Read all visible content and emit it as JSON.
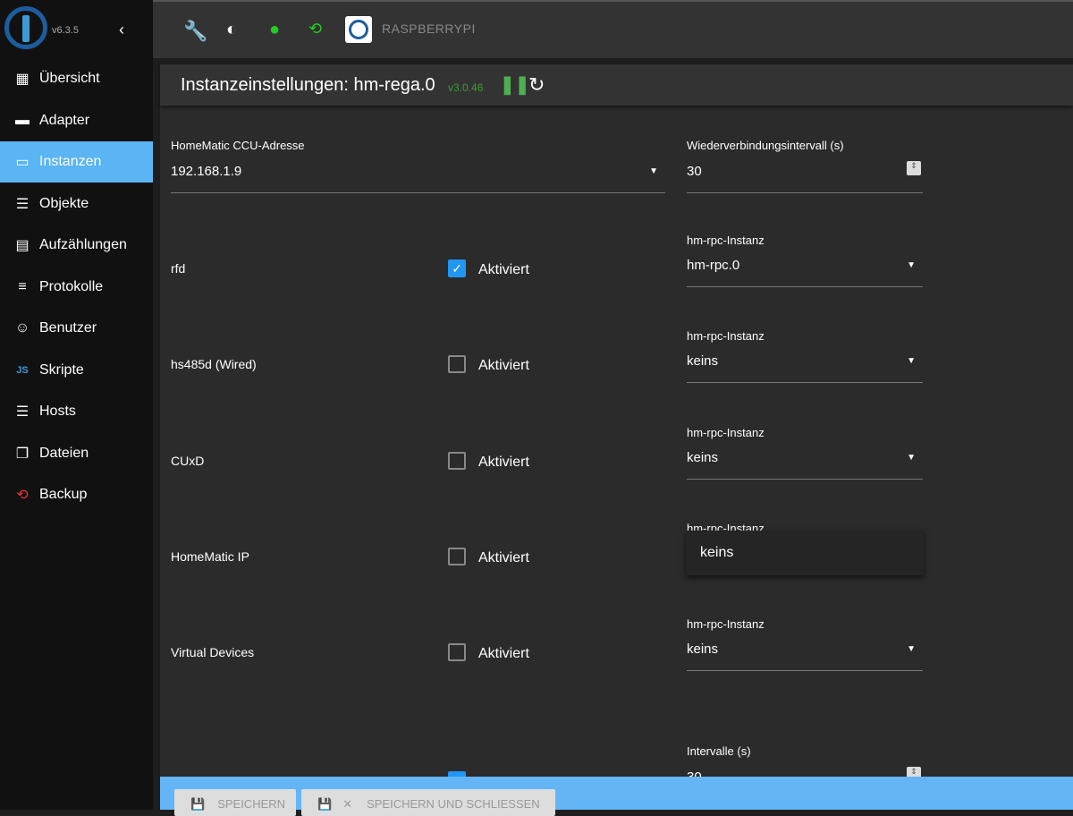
{
  "sidebar": {
    "version": "v6.3.5",
    "items": [
      {
        "label": "Übersicht",
        "icon": "grid-icon"
      },
      {
        "label": "Adapter",
        "icon": "store-icon"
      },
      {
        "label": "Instanzen",
        "icon": "instances-icon",
        "active": true
      },
      {
        "label": "Objekte",
        "icon": "list-icon"
      },
      {
        "label": "Aufzählungen",
        "icon": "enum-icon"
      },
      {
        "label": "Protokolle",
        "icon": "log-icon"
      },
      {
        "label": "Benutzer",
        "icon": "user-icon"
      },
      {
        "label": "Skripte",
        "icon": "js-icon"
      },
      {
        "label": "Hosts",
        "icon": "hosts-icon"
      },
      {
        "label": "Dateien",
        "icon": "file-icon"
      },
      {
        "label": "Backup",
        "icon": "backup-icon"
      }
    ]
  },
  "topbar": {
    "host": "RASPBERRYPI"
  },
  "panel": {
    "title": "Instanzeinstellungen: hm-rega.0",
    "version": "v3.0.46",
    "ccu_label": "HomeMatic CCU-Adresse",
    "ccu_value": "192.168.1.9",
    "reconnect_label": "Wiederverbindungsintervall (s)",
    "reconnect_value": "30",
    "rows": [
      {
        "label": "rfd",
        "checked": true,
        "check_label": "Aktiviert",
        "inst_label": "hm-rpc-Instanz",
        "inst_value": "hm-rpc.0"
      },
      {
        "label": "hs485d (Wired)",
        "checked": false,
        "check_label": "Aktiviert",
        "inst_label": "hm-rpc-Instanz",
        "inst_value": "keins"
      },
      {
        "label": "CUxD",
        "checked": false,
        "check_label": "Aktiviert",
        "inst_label": "hm-rpc-Instanz",
        "inst_value": "keins"
      },
      {
        "label": "HomeMatic IP",
        "checked": false,
        "check_label": "Aktiviert",
        "inst_label": "hm-rpc-Instanz",
        "inst_value": "keins"
      },
      {
        "label": "Virtual Devices",
        "checked": false,
        "check_label": "Aktiviert",
        "inst_label": "hm-rpc-Instanz",
        "inst_value": "keins"
      }
    ],
    "interval_label": "Intervalle (s)",
    "interval_value": "30"
  },
  "footer": {
    "save": "SPEICHERN",
    "save_close": "SPEICHERN UND SCHLIESSEN"
  },
  "colors": {
    "accent": "#5bb4f3",
    "footer": "#64b5f6",
    "checkbox": "#2196f3"
  }
}
